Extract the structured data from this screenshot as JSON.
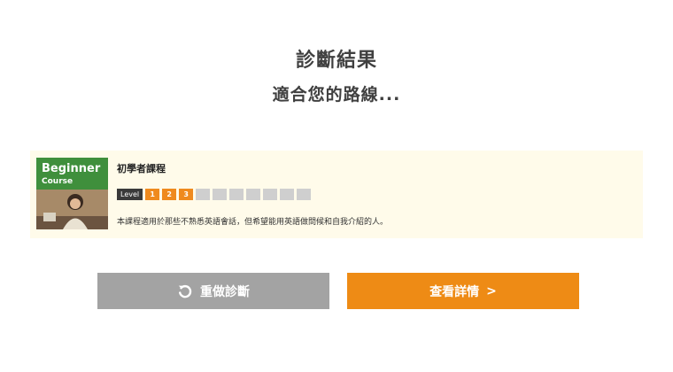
{
  "header": {
    "title": "診斷結果",
    "subtitle": "適合您的路線..."
  },
  "course": {
    "thumbnail": {
      "title_line1": "Beginner",
      "title_line2": "Course"
    },
    "name": "初學者課程",
    "level": {
      "label": "Level",
      "current": 3,
      "max": 10,
      "filled_numbers": [
        "1",
        "2",
        "3"
      ]
    },
    "description": "本課程適用於那些不熟悉英語會話，但希望能用英語做問候和自我介紹的人。"
  },
  "buttons": {
    "retake_label": "重做診斷",
    "retake_icon": "refresh-icon",
    "details_label": "查看詳情",
    "details_arrow": ">"
  },
  "colors": {
    "accent_orange": "#ee8b15",
    "button_gray": "#a3a3a3",
    "card_background": "#fffbea",
    "thumb_green": "#3f8f3c"
  }
}
